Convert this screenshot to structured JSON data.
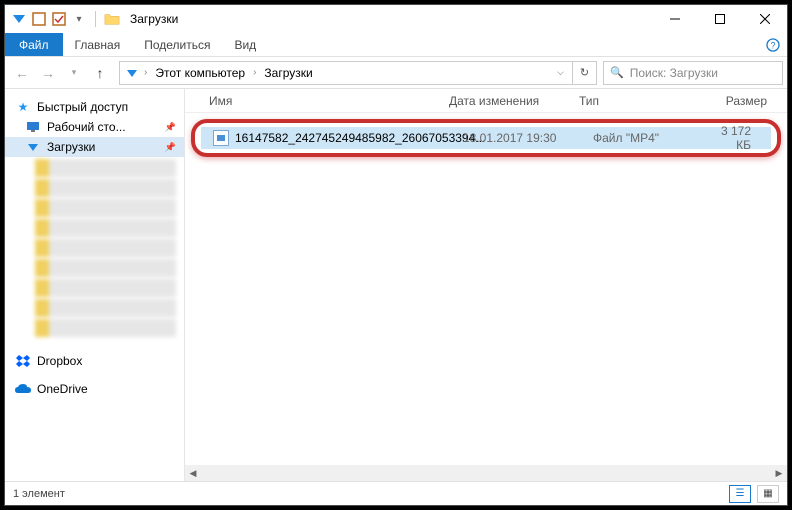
{
  "window": {
    "title": "Загрузки"
  },
  "ribbon": {
    "file": "Файл",
    "home": "Главная",
    "share": "Поделиться",
    "view": "Вид"
  },
  "breadcrumb": {
    "root": "Этот компьютер",
    "current": "Загрузки"
  },
  "search": {
    "placeholder": "Поиск: Загрузки"
  },
  "columns": {
    "name": "Имя",
    "date": "Дата изменения",
    "type": "Тип",
    "size": "Размер"
  },
  "sidebar": {
    "quick_access": "Быстрый доступ",
    "desktop": "Рабочий сто...",
    "downloads": "Загрузки",
    "dropbox": "Dropbox",
    "onedrive": "OneDrive"
  },
  "files": [
    {
      "name": "16147582_242745249485982_26067053394...",
      "date": "18.01.2017 19:30",
      "type": "Файл \"MP4\"",
      "size": "3 172 КБ"
    }
  ],
  "status": {
    "count": "1 элемент"
  }
}
